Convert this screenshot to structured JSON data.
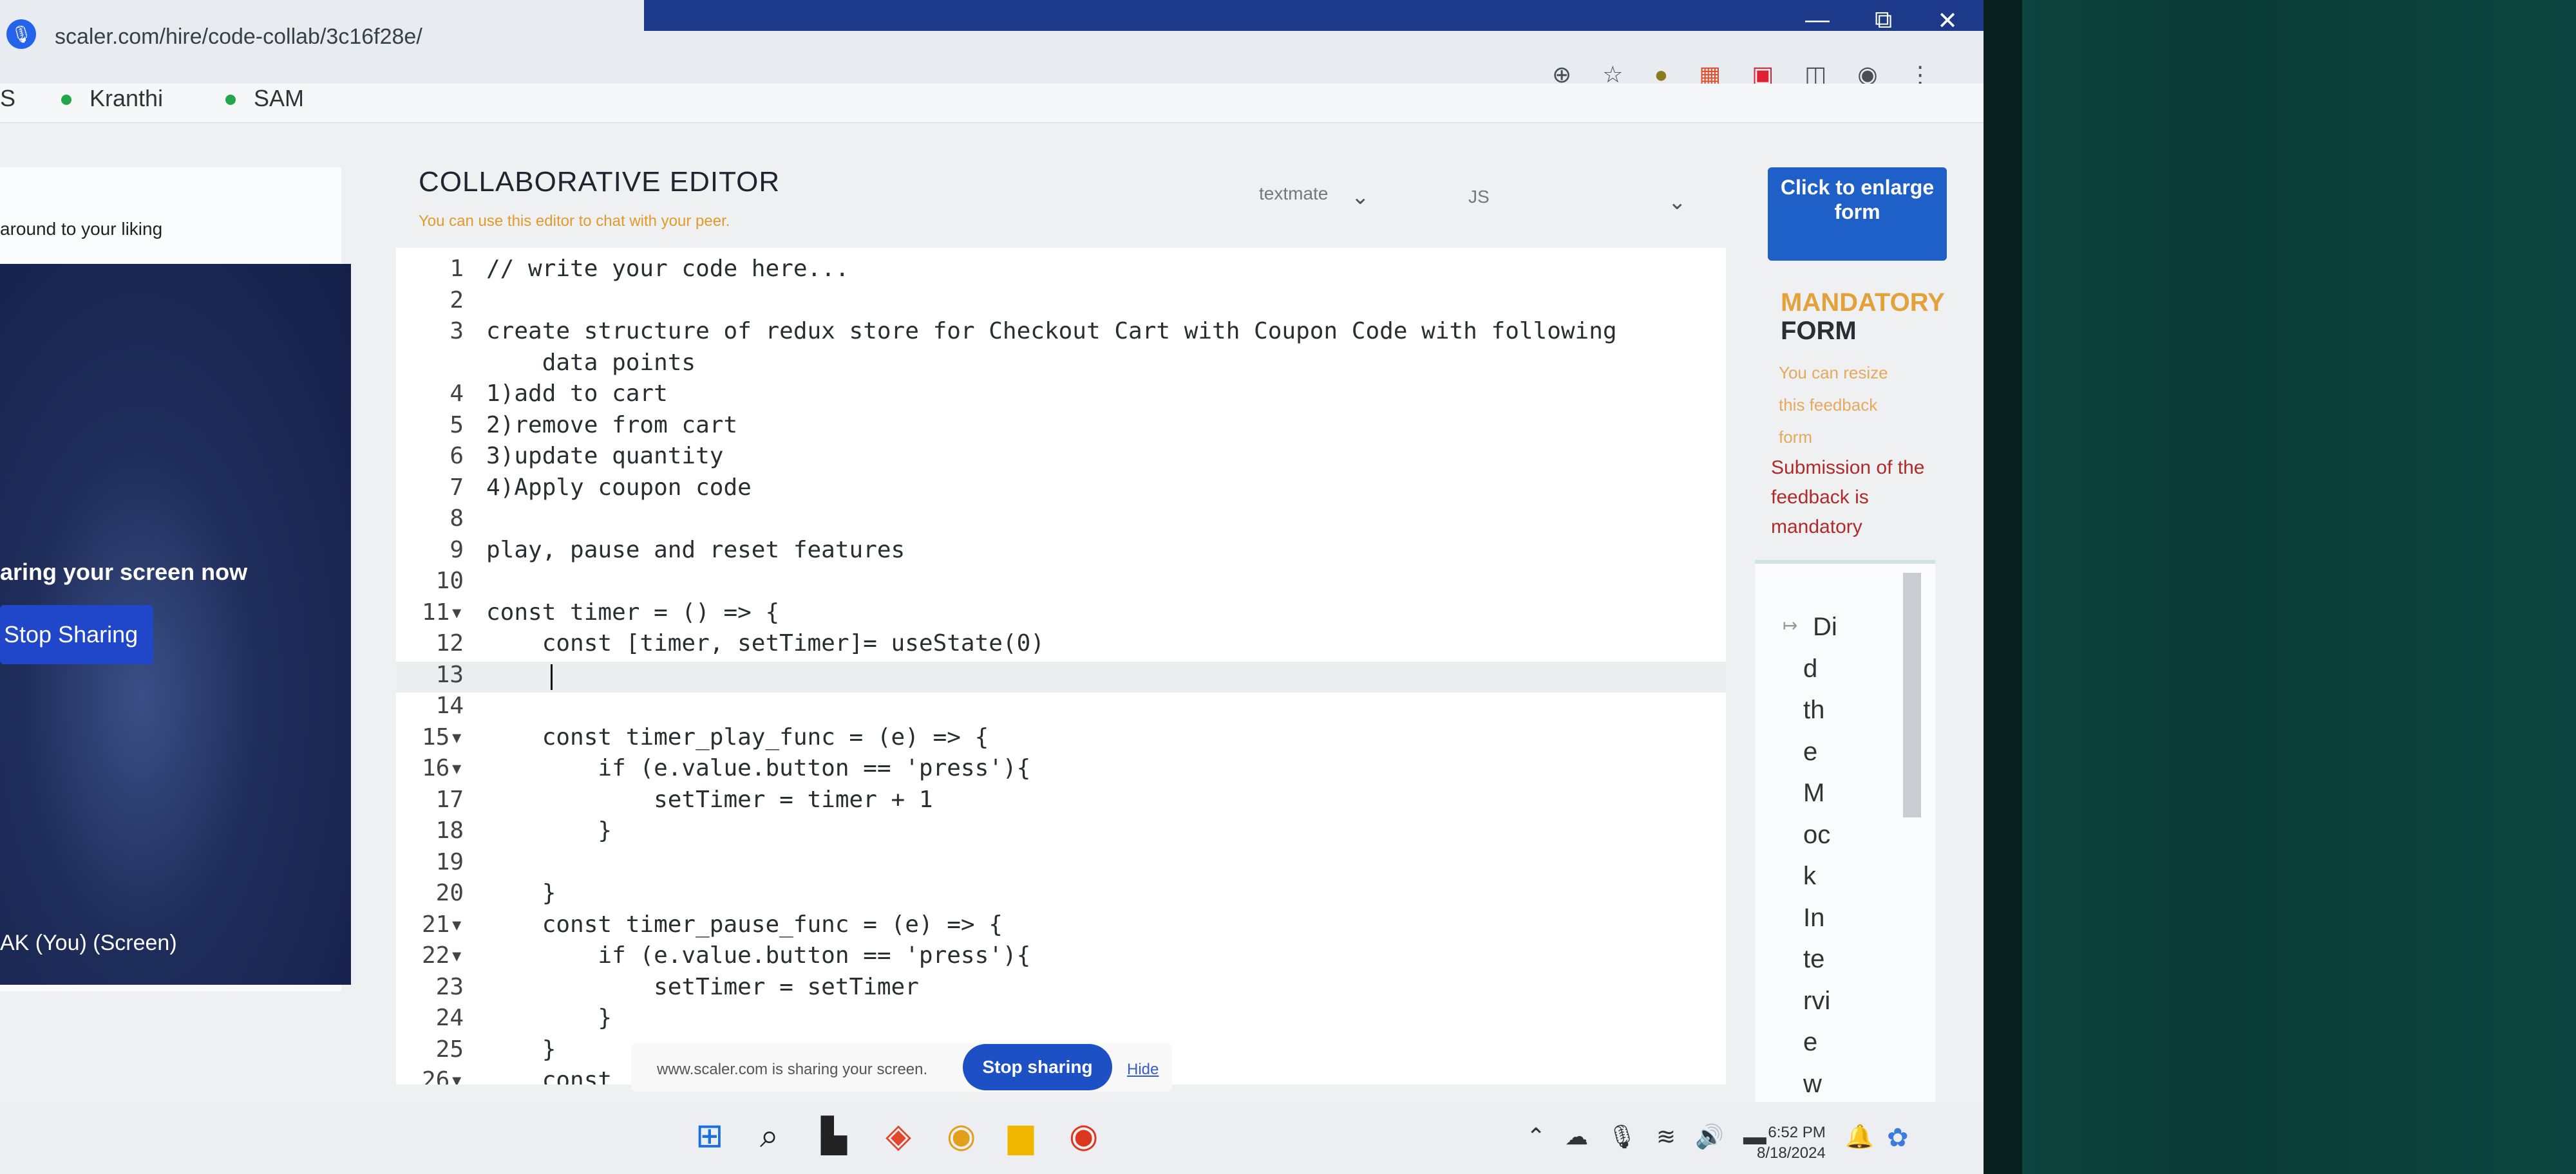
{
  "browser": {
    "url": "scaler.com/hire/code-collab/3c16f28e/",
    "toolbar_icons": [
      "zoom-icon",
      "star-icon",
      "extension-o-icon",
      "grid-icon",
      "percent-icon",
      "puzzle-icon",
      "profile-icon",
      "more-icon"
    ],
    "window_controls": [
      "—",
      "⧉",
      "✕"
    ]
  },
  "participants": {
    "partial": "S",
    "items": [
      {
        "name": "Kranthi"
      },
      {
        "name": "SAM"
      }
    ]
  },
  "left_panel": {
    "hint": "around to your liking",
    "sharing_text": "aring your screen now",
    "stop_button": "Stop Sharing",
    "screen_label": "AK (You) (Screen)"
  },
  "editor": {
    "title": "COLLABORATIVE EDITOR",
    "subtitle": "You can use this editor to chat with your peer.",
    "theme": "textmate",
    "language": "JS",
    "lines": [
      {
        "n": "1",
        "t": "// write your code here..."
      },
      {
        "n": "2",
        "t": ""
      },
      {
        "n": "3",
        "t": "create structure of redux store for Checkout Cart with Coupon Code with following"
      },
      {
        "n": "",
        "t": "    data points"
      },
      {
        "n": "4",
        "t": "1)add to cart"
      },
      {
        "n": "5",
        "t": "2)remove from cart"
      },
      {
        "n": "6",
        "t": "3)update quantity"
      },
      {
        "n": "7",
        "t": "4)Apply coupon code"
      },
      {
        "n": "8",
        "t": ""
      },
      {
        "n": "9",
        "t": "play, pause and reset features"
      },
      {
        "n": "10",
        "t": ""
      },
      {
        "n": "11▾",
        "t": "const timer = () => {"
      },
      {
        "n": "12",
        "t": "    const [timer, setTimer]= useState(0)"
      },
      {
        "n": "13",
        "t": ""
      },
      {
        "n": "14",
        "t": ""
      },
      {
        "n": "15▾",
        "t": "    const timer_play_func = (e) => {"
      },
      {
        "n": "16▾",
        "t": "        if (e.value.button == 'press'){"
      },
      {
        "n": "17",
        "t": "            setTimer = timer + 1"
      },
      {
        "n": "18",
        "t": "        }"
      },
      {
        "n": "19",
        "t": ""
      },
      {
        "n": "20",
        "t": "    }"
      },
      {
        "n": "21▾",
        "t": "    const timer_pause_func = (e) => {"
      },
      {
        "n": "22▾",
        "t": "        if (e.value.button == 'press'){"
      },
      {
        "n": "23",
        "t": "            setTimer = setTimer"
      },
      {
        "n": "24",
        "t": "        }"
      },
      {
        "n": "25",
        "t": "    }"
      },
      {
        "n": "26▾",
        "t": "    const"
      }
    ]
  },
  "form": {
    "enlarge_button": "Click to enlarge form",
    "mandatory": "MANDATORY",
    "form_word": "FORM",
    "resize_hint": "You can resize this feedback form",
    "submission_note": "Submission of the feedback is mandatory",
    "vertical_text": [
      "Di",
      "d",
      "th",
      "e",
      "M",
      "oc",
      "k",
      "In",
      "te",
      "rvi",
      "e",
      "w"
    ]
  },
  "share_banner": {
    "message": "www.scaler.com is sharing your screen.",
    "stop": "Stop sharing",
    "hide": "Hide"
  },
  "taskbar": {
    "time": "6:52 PM",
    "date": "8/18/2024"
  }
}
